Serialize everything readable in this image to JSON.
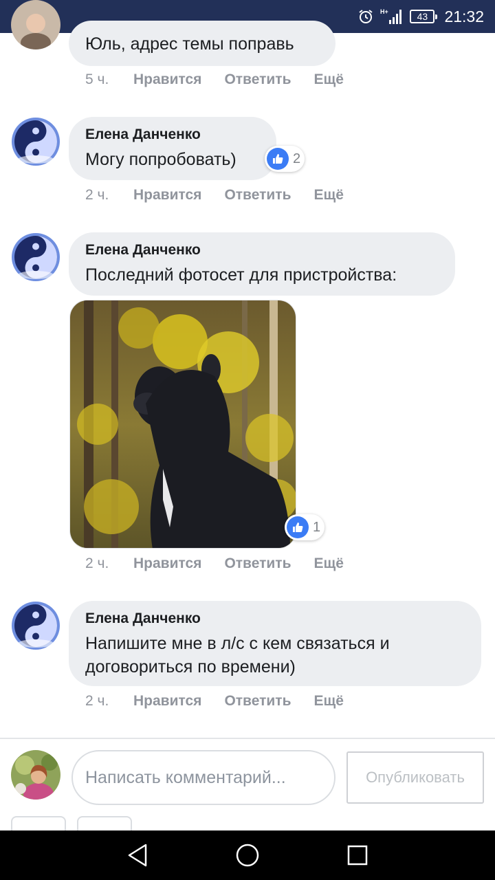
{
  "status_bar": {
    "time": "21:32",
    "battery": "43",
    "network": "H+",
    "icons": [
      "alarm-icon",
      "signal-icon",
      "battery-icon"
    ]
  },
  "comments": [
    {
      "author": "",
      "text": "Юль, адрес темы поправь",
      "time": "5 ч.",
      "like": "Нравится",
      "reply": "Ответить",
      "more": "Ещё"
    },
    {
      "author": "Елена Данченко",
      "text": "Могу попробовать)",
      "time": "2 ч.",
      "like": "Нравится",
      "reply": "Ответить",
      "more": "Ещё",
      "reactions": "2"
    },
    {
      "author": "Елена Данченко",
      "text": "Последний фотосет для пристройства:",
      "time": "2 ч.",
      "like": "Нравится",
      "reply": "Ответить",
      "more": "Ещё",
      "photo_reactions": "1"
    },
    {
      "author": "Елена Данченко",
      "text_line1": "Напишите мне в л/с с кем связаться и",
      "text_line2": "договориться по времени)",
      "time": "2 ч.",
      "like": "Нравится",
      "reply": "Ответить",
      "more": "Ещё"
    }
  ],
  "composer": {
    "placeholder": "Написать комментарий...",
    "publish": "Опубликовать"
  },
  "colors": {
    "status_bar": "#223058",
    "bubble": "#eceef1",
    "meta_text": "#90949c",
    "like_blue": "#3b7cf5"
  }
}
